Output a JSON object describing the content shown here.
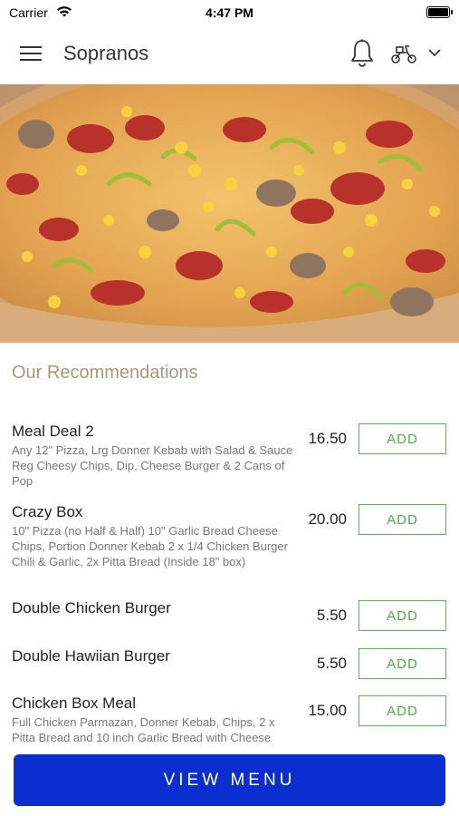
{
  "status_bar": {
    "carrier": "Carrier",
    "time": "4:47 PM"
  },
  "header": {
    "title": "Sopranos"
  },
  "hero": {
    "description": ""
  },
  "recommendations": {
    "title": "Our Recommendations",
    "add_label": "ADD",
    "items": [
      {
        "name": "Meal Deal 2",
        "description": "Any 12\" Pizza, Lrg Donner Kebab with Salad & Sauce Reg Cheesy Chips, Dip, Cheese Burger & 2 Cans of Pop",
        "price": "16.50"
      },
      {
        "name": "Crazy Box",
        "description": "10\" Pizza (no Half & Half) 10\" Garlic Bread Cheese Chips, Portion Donner Kebab 2 x 1/4 Chicken Burger Chili & Garlic, 2x Pitta Bread (Inside 18\" box)",
        "price": "20.00"
      },
      {
        "name": "Double Chicken Burger",
        "description": "",
        "price": "5.50"
      },
      {
        "name": "Double Hawiian Burger",
        "description": "",
        "price": "5.50"
      },
      {
        "name": "Chicken Box Meal",
        "description": "Full Chicken Parmazan, Donner Kebab, Chips,  2 x Pitta Bread and 10 inch Garlic Bread with Cheese",
        "price": "15.00"
      }
    ]
  },
  "footer": {
    "view_menu_label": "VIEW MENU"
  },
  "colors": {
    "accent_green": "#5cb85c",
    "primary_blue": "#0a2ed0",
    "heading_tan": "#a79a7a"
  }
}
